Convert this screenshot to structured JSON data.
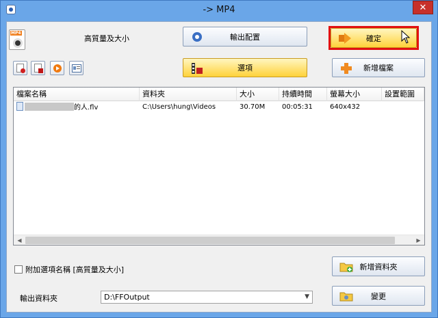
{
  "window": {
    "title": "-> MP4",
    "close_glyph": "✕"
  },
  "preset": {
    "label": "高質量及大小",
    "icon": "mp4-file-icon",
    "badge": "MP4"
  },
  "buttons": {
    "output_config": "輸出配置",
    "ok": "確定",
    "options": "選項",
    "add_files": "新增檔案",
    "add_folder": "新增資料夾",
    "change": "變更"
  },
  "file_table": {
    "columns": [
      "檔案名稱",
      "資料夾",
      "大小",
      "持續時間",
      "螢幕大小",
      "設置範圍"
    ],
    "rows": [
      {
        "name": "的人.flv",
        "folder": "C:\\Users\\hung\\Videos",
        "size": "30.70M",
        "duration": "00:05:31",
        "screen": "640x432",
        "range": ""
      }
    ]
  },
  "append_option": {
    "label": "附加選項名稱 [高質量及大小]",
    "checked": false
  },
  "output_folder": {
    "label": "輸出資料夾",
    "value": "D:\\FFOutput"
  },
  "colors": {
    "accent_yellow": "#ffd23a",
    "highlight_red": "#e21010",
    "title_blue": "#6aa6e8"
  }
}
